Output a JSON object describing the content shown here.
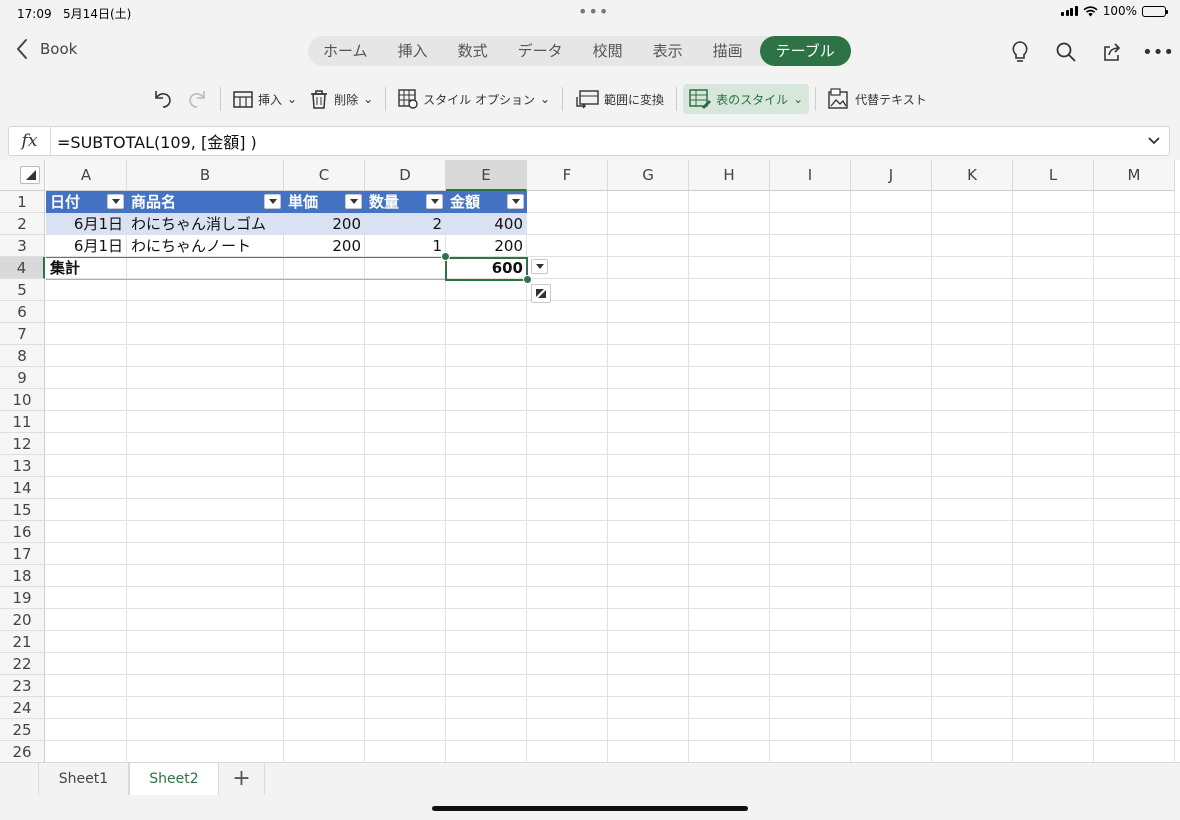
{
  "status": {
    "time": "17:09",
    "date": "5月14日(土)",
    "battery": "100%"
  },
  "header": {
    "back_label": "Book",
    "tabs": [
      "ホーム",
      "挿入",
      "数式",
      "データ",
      "校閲",
      "表示",
      "描画",
      "テーブル"
    ],
    "active_tab": "テーブル",
    "accent": "#2d7345"
  },
  "toolbar": {
    "insert": "挿入",
    "delete": "削除",
    "style_options": "スタイル オプション",
    "convert_to_range": "範囲に変換",
    "table_style": "表のスタイル",
    "alt_text": "代替テキスト"
  },
  "formula_bar": {
    "fx": "fx",
    "formula": "=SUBTOTAL(109, [金額] )"
  },
  "grid": {
    "columns": [
      "A",
      "B",
      "C",
      "D",
      "E",
      "F",
      "G",
      "H",
      "I",
      "J",
      "K",
      "L",
      "M"
    ],
    "selected_column": "E",
    "rows": [
      "1",
      "2",
      "3",
      "4",
      "5",
      "6",
      "7",
      "8",
      "9",
      "10",
      "11",
      "12",
      "13",
      "14",
      "15",
      "16",
      "17",
      "18",
      "19",
      "20",
      "21",
      "22",
      "23",
      "24",
      "25",
      "26"
    ],
    "table_header": [
      "日付",
      "商品名",
      "単価",
      "数量",
      "金額"
    ],
    "table_rows": [
      [
        "6月1日",
        "わにちゃん消しゴム",
        "200",
        "2",
        "400"
      ],
      [
        "6月1日",
        "わにちゃんノート",
        "200",
        "1",
        "200"
      ]
    ],
    "total_row": {
      "label": "集計",
      "value": "600"
    },
    "header_color": "#4472c4",
    "band_color": "#d9e1f2"
  },
  "sheets": {
    "tabs": [
      "Sheet1",
      "Sheet2"
    ],
    "active": "Sheet2",
    "add": "+"
  }
}
